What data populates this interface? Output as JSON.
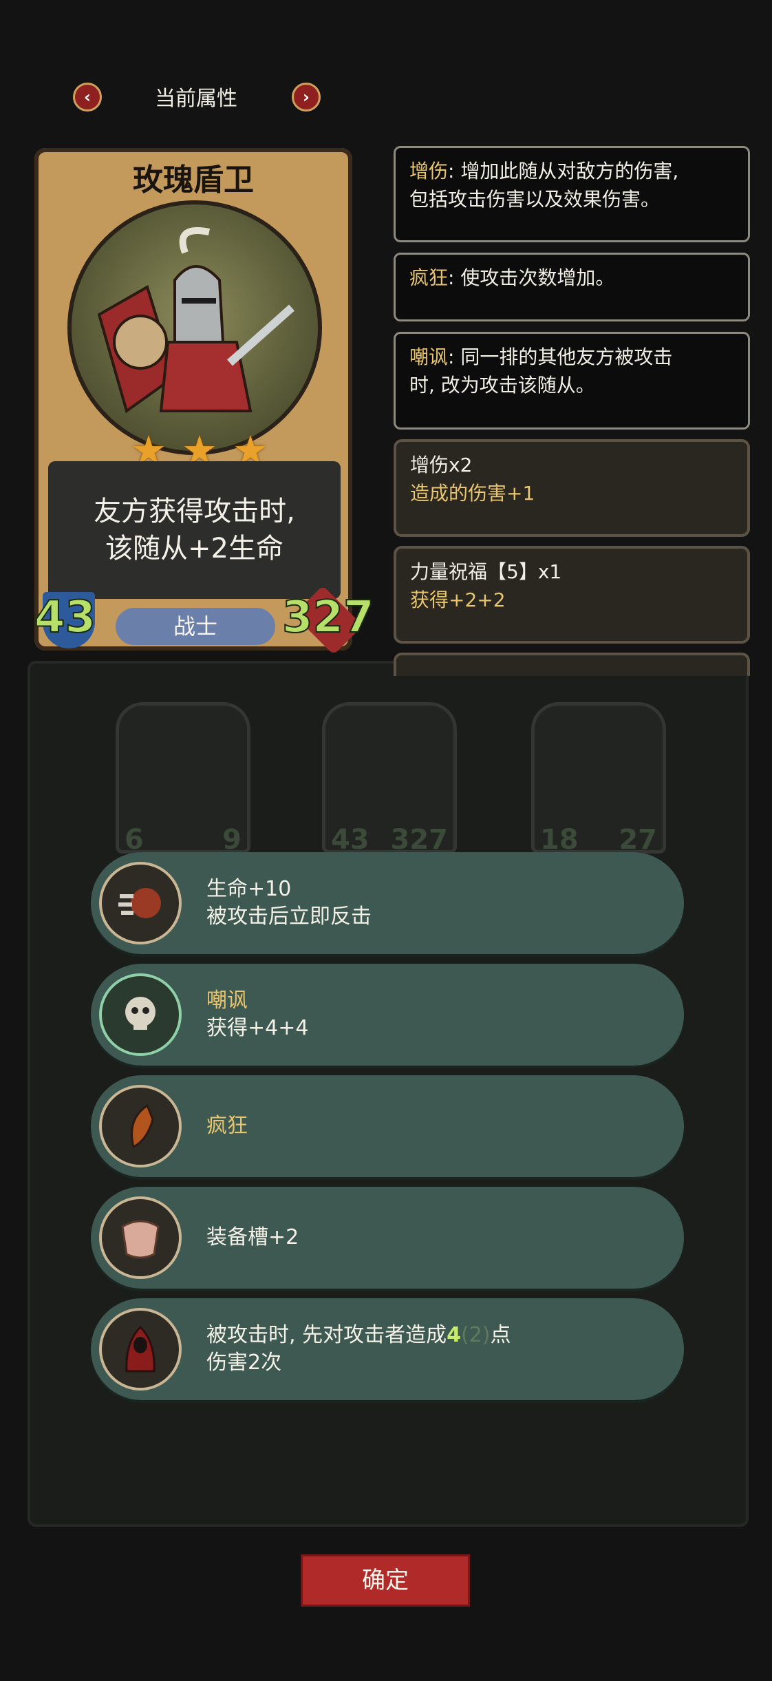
{
  "header": {
    "title": "当前属性"
  },
  "card": {
    "name": "玫瑰盾卫",
    "stars": 3,
    "desc_line1": "友方获得攻击时,",
    "desc_line2": "该随从+2生命",
    "attack": "43",
    "health": "327",
    "class": "战士"
  },
  "keywords": [
    {
      "term": "增伤",
      "text": ": 增加此随从对敌方的伤害,",
      "text2": "包括攻击伤害以及效果伤害。"
    },
    {
      "term": "疯狂",
      "text": ": 使攻击次数增加。"
    },
    {
      "term": "嘲讽",
      "text": ": 同一排的其他友方被攻击",
      "text2": "时, 改为攻击该随从。"
    }
  ],
  "buffs": [
    {
      "title": "增伤x2",
      "sub": "造成的伤害+1"
    },
    {
      "title": "力量祝福【5】x1",
      "sub": "获得+2+2"
    }
  ],
  "board": {
    "minions": [
      {
        "atk": "6",
        "hp": "9"
      },
      {
        "atk": "43",
        "hp": "327"
      },
      {
        "atk": "18",
        "hp": "27"
      }
    ]
  },
  "effects": [
    {
      "icon": "fist-icon",
      "line1": "生命+10",
      "line2": "被攻击后立即反击"
    },
    {
      "icon": "skull-icon",
      "line1": "嘲讽",
      "line2": "获得+4+4"
    },
    {
      "icon": "horn-icon",
      "line1": "疯狂"
    },
    {
      "icon": "armor-icon",
      "line1": "装备槽+2"
    },
    {
      "icon": "cloak-icon",
      "line1_pre": "被攻击时, 先对攻击者造成",
      "line1_num": "4",
      "line1_dim": "(2)",
      "line1_post": "点",
      "line2": "伤害2次"
    }
  ],
  "confirm_label": "确定"
}
